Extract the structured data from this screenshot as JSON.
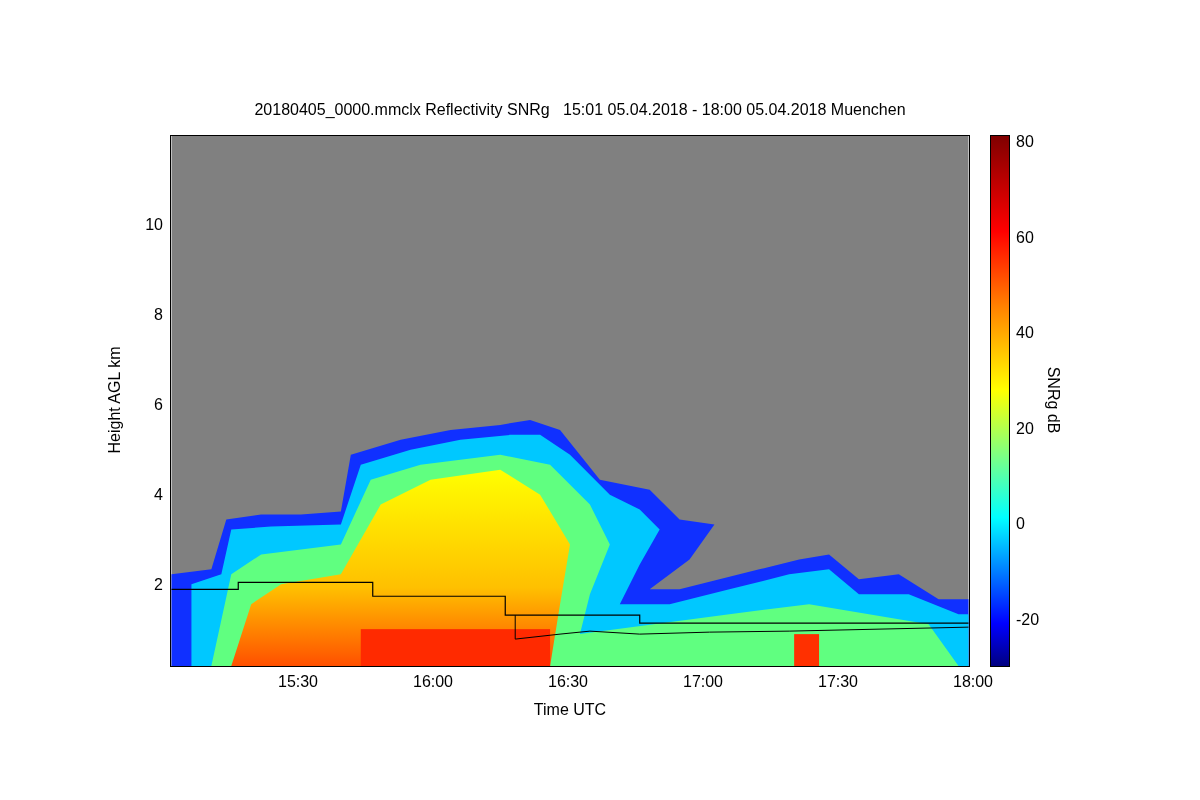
{
  "title": "20180405_0000.mmclx Reflectivity SNRg   15:01 05.04.2018 - 18:00 05.04.2018 Muenchen",
  "y_axis": {
    "label": "Height AGL km",
    "ticks": [
      "10",
      "8",
      "6",
      "4",
      "2"
    ]
  },
  "x_axis": {
    "label": "Time UTC",
    "ticks": [
      "15:30",
      "16:00",
      "16:30",
      "17:00",
      "17:30",
      "18:00"
    ]
  },
  "colorbar": {
    "label": "SNRg dB",
    "ticks": [
      "80",
      "60",
      "40",
      "20",
      "0",
      "-20"
    ]
  }
}
